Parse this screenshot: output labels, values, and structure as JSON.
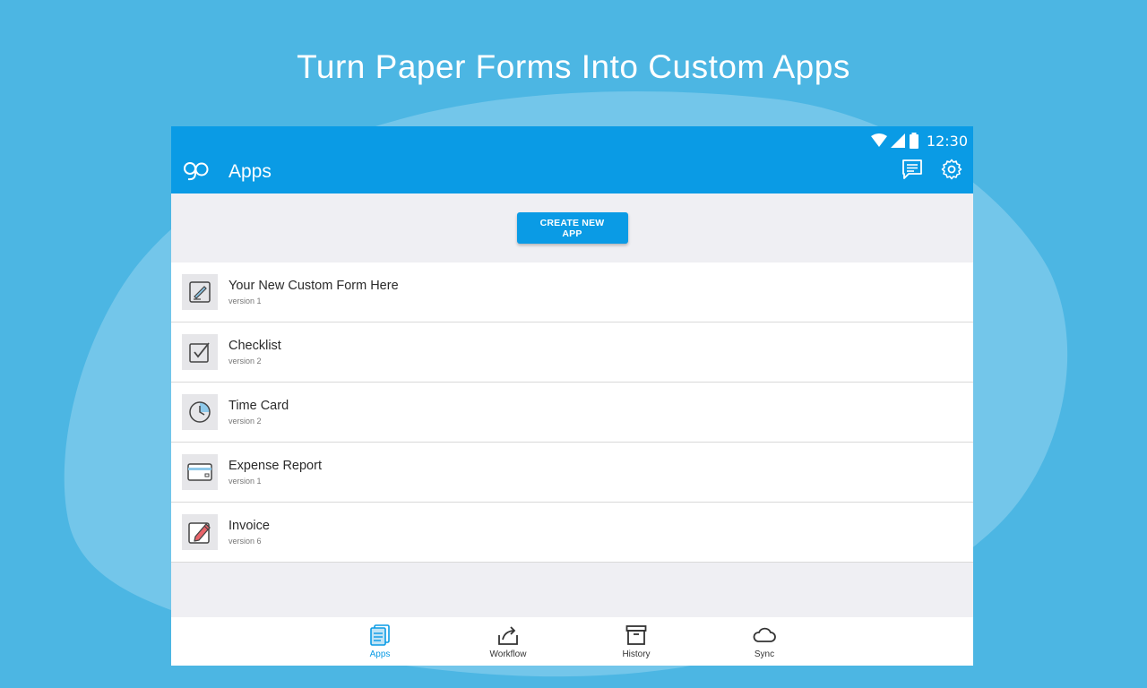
{
  "headline": "Turn Paper Forms Into Custom Apps",
  "status_bar": {
    "time": "12:30"
  },
  "app_bar": {
    "title": "Apps",
    "icons": [
      "messages-icon",
      "settings-gear-icon"
    ]
  },
  "create_button": {
    "label": "CREATE NEW APP"
  },
  "apps": [
    {
      "name": "Your New Custom Form Here",
      "version": "version 1",
      "icon": "custom-form-icon"
    },
    {
      "name": "Checklist",
      "version": "version 2",
      "icon": "checklist-icon"
    },
    {
      "name": "Time Card",
      "version": "version 2",
      "icon": "clock-icon"
    },
    {
      "name": "Expense Report",
      "version": "version 1",
      "icon": "credit-card-icon"
    },
    {
      "name": "Invoice",
      "version": "version 6",
      "icon": "pencil-edit-icon"
    }
  ],
  "bottom_nav": {
    "items": [
      {
        "label": "Apps",
        "active": true,
        "icon": "apps-stack-icon"
      },
      {
        "label": "Workflow",
        "active": false,
        "icon": "share-tray-icon"
      },
      {
        "label": "History",
        "active": false,
        "icon": "archive-box-icon"
      },
      {
        "label": "Sync",
        "active": false,
        "icon": "cloud-icon"
      }
    ]
  },
  "colors": {
    "background": "#4cb6e3",
    "primary": "#0a9be5",
    "blob": "#73c6ea"
  }
}
